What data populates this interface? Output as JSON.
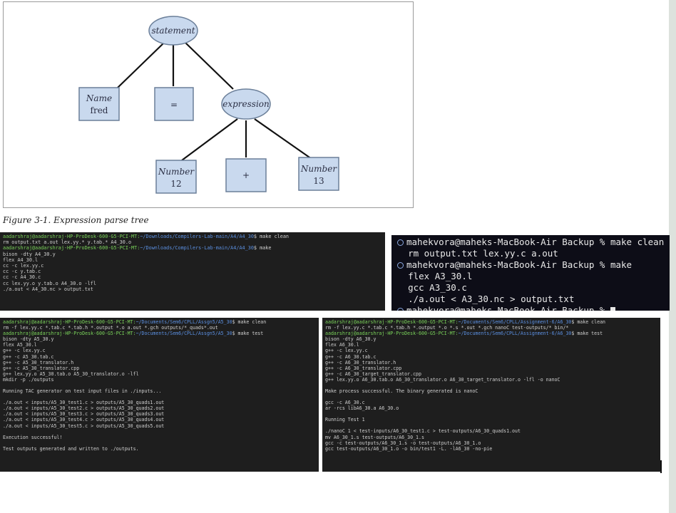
{
  "figure": {
    "caption": "Figure 3-1. Expression parse tree",
    "nodes": {
      "statement": "statement",
      "name_label": "Name",
      "name_value": "fred",
      "equals": "=",
      "expression": "expression",
      "number_left_label": "Number",
      "number_left_value": "12",
      "plus": "+",
      "number_right_label": "Number",
      "number_right_value": "13"
    },
    "colors": {
      "node_fill": "#c9d9ee",
      "node_stroke": "#6b7f99",
      "edge": "#111111"
    }
  },
  "term1": {
    "lines": [
      {
        "prompt": "aadarshraj@aadarshraj-HP-ProDesk-600-G5-PCI-MT:",
        "path": "~/Downloads/Compilers-Lab-main/A4/A4_30",
        "cmd": "$ make clean"
      },
      {
        "text": "rm output.txt a.out lex.yy.* y.tab.* A4_30.o"
      },
      {
        "prompt": "aadarshraj@aadarshraj-HP-ProDesk-600-G5-PCI-MT:",
        "path": "~/Downloads/Compilers-Lab-main/A4/A4_30",
        "cmd": "$ make"
      },
      {
        "text": "bison -dty A4_30.y"
      },
      {
        "text": "flex A4_30.l"
      },
      {
        "text": "cc -c lex.yy.c"
      },
      {
        "text": "cc -c y.tab.c"
      },
      {
        "text": "cc -c A4_30.c"
      },
      {
        "text": "cc lex.yy.o y.tab.o A4_30.o -lfl"
      },
      {
        "text": "./a.out < A4_30.nc > output.txt"
      }
    ]
  },
  "term2": {
    "lines": [
      {
        "text": "mahekvora@maheks-MacBook-Air Backup % make clean"
      },
      {
        "text": "rm output.txt lex.yy.c a.out"
      },
      {
        "text": "mahekvora@maheks-MacBook-Air Backup % make"
      },
      {
        "text": "flex A3_30.l"
      },
      {
        "text": "gcc A3_30.c"
      },
      {
        "text": "./a.out < A3_30.nc > output.txt"
      },
      {
        "text": "mahekvora@maheks-MacBook-Air Backup % "
      }
    ]
  },
  "term3": {
    "lines": [
      {
        "prompt": "aadarshraj@aadarshraj-HP-ProDesk-600-G5-PCI-MT:",
        "path": "~/Documents/Sem6/CPLL/Assgn5/A5_30",
        "cmd": "$ make clean"
      },
      {
        "text": "rm -f lex.yy.c *.tab.c *.tab.h *.output *.o a.out *.gch outputs/*_quads*.out"
      },
      {
        "prompt": "aadarshraj@aadarshraj-HP-ProDesk-600-G5-PCI-MT:",
        "path": "~/Documents/Sem6/CPLL/Assgn5/A5_30",
        "cmd": "$ make test"
      },
      {
        "text": "bison -dty A5_30.y"
      },
      {
        "text": "flex A5_30.l"
      },
      {
        "text": "g++ -c lex.yy.c"
      },
      {
        "text": "g++ -c A5_30.tab.c"
      },
      {
        "text": "g++ -c A5_30_translator.h"
      },
      {
        "text": "g++ -c A5_30_translator.cpp"
      },
      {
        "text": "g++ lex.yy.o A5_30.tab.o A5_30_translator.o -lfl"
      },
      {
        "text": "mkdir -p ./outputs"
      },
      {
        "text": ""
      },
      {
        "text": "Running TAC generator on test input files in ./inputs..."
      },
      {
        "text": ""
      },
      {
        "text": "./a.out < inputs/A5_30_test1.c > outputs/A5_30_quads1.out"
      },
      {
        "text": "./a.out < inputs/A5_30_test2.c > outputs/A5_30_quads2.out"
      },
      {
        "text": "./a.out < inputs/A5_30_test3.c > outputs/A5_30_quads3.out"
      },
      {
        "text": "./a.out < inputs/A5_30_test4.c > outputs/A5_30_quads4.out"
      },
      {
        "text": "./a.out < inputs/A5_30_test5.c > outputs/A5_30_quads5.out"
      },
      {
        "text": ""
      },
      {
        "text": "Execution successful!"
      },
      {
        "text": ""
      },
      {
        "text": "Test outputs generated and written to ./outputs."
      }
    ]
  },
  "term4": {
    "lines": [
      {
        "prompt": "aadarshraj@aadarshraj-HP-ProDesk-600-G5-PCI-MT:",
        "path": "~/Documents/Sem6/CPLL/Assignment-6/A6_30",
        "cmd": "$ make clean"
      },
      {
        "text": "rm -f lex.yy.c *.tab.c *.tab.h *.output *.o *.s *.out *.gch nanoC test-outputs/* bin/*"
      },
      {
        "prompt": "aadarshraj@aadarshraj-HP-ProDesk-600-G5-PCI-MT:",
        "path": "~/Documents/Sem6/CPLL/Assignment-6/A6_30",
        "cmd": "$ make test"
      },
      {
        "text": "bison -dty A6_30.y"
      },
      {
        "text": "flex A6_30.l"
      },
      {
        "text": "g++ -c lex.yy.c"
      },
      {
        "text": "g++ -c A6_30.tab.c"
      },
      {
        "text": "g++ -c A6_30_translator.h"
      },
      {
        "text": "g++ -c A6_30_translator.cpp"
      },
      {
        "text": "g++ -c A6_30_target_translator.cpp"
      },
      {
        "text": "g++ lex.yy.o A6_30.tab.o A6_30_translator.o A6_30_target_translator.o -lfl -o nanoC"
      },
      {
        "text": ""
      },
      {
        "text": "Make process successful. The binary generated is nanoC"
      },
      {
        "text": ""
      },
      {
        "text": "gcc -c A6_30.c"
      },
      {
        "text": "ar -rcs libA6_30.a A6_30.o"
      },
      {
        "text": ""
      },
      {
        "text": "Running Test 1"
      },
      {
        "text": ""
      },
      {
        "text": "./nanoC 1 < test-inputs/A6_30_test1.c > test-outputs/A6_30_quads1.out"
      },
      {
        "text": "mv A6_30_1.s test-outputs/A6_30_1.s"
      },
      {
        "text": "gcc -c test-outputs/A6_30_1.s -o test-outputs/A6_30_1.o"
      },
      {
        "text": "gcc test-outputs/A6_30_1.o -o bin/test1 -L. -lA6_30 -no-pie"
      }
    ]
  }
}
